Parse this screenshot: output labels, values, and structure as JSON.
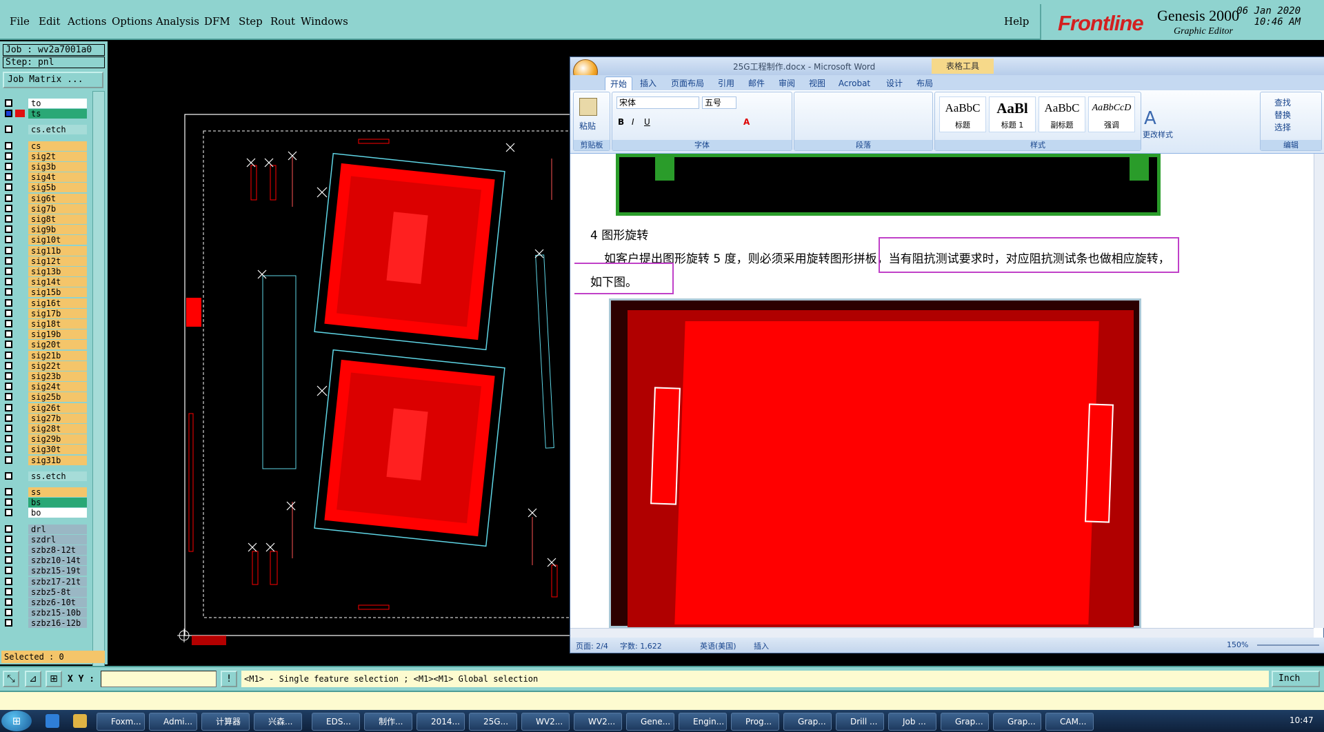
{
  "menu": {
    "file": "File",
    "edit": "Edit",
    "actions": "Actions",
    "options": "Options",
    "analysis": "Analysis",
    "dfm": "DFM",
    "step": "Step",
    "rout": "Rout",
    "windows": "Windows",
    "help": "Help"
  },
  "brand": {
    "logo": "Frontline",
    "product": "Genesis 2000",
    "module": "Graphic Editor",
    "date": "06 Jan 2020",
    "time": "10:46 AM"
  },
  "panel": {
    "job": "Job : wv2a7001a0",
    "step": "Step: pnl",
    "job_matrix": "Job Matrix ...",
    "selected": "Selected : 0",
    "layers": [
      {
        "name": "to",
        "color": "#ffffff"
      },
      {
        "name": "ts",
        "color": "#2aa876"
      },
      {
        "name": "cs.etch",
        "color": "#a6dcd8"
      },
      {
        "name": "cs",
        "color": "#f4c56a"
      },
      {
        "name": "sig2t",
        "color": "#f4c56a"
      },
      {
        "name": "sig3b",
        "color": "#f4c56a"
      },
      {
        "name": "sig4t",
        "color": "#f4c56a"
      },
      {
        "name": "sig5b",
        "color": "#f4c56a"
      },
      {
        "name": "sig6t",
        "color": "#f4c56a"
      },
      {
        "name": "sig7b",
        "color": "#f4c56a"
      },
      {
        "name": "sig8t",
        "color": "#f4c56a"
      },
      {
        "name": "sig9b",
        "color": "#f4c56a"
      },
      {
        "name": "sig10t",
        "color": "#f4c56a"
      },
      {
        "name": "sig11b",
        "color": "#f4c56a"
      },
      {
        "name": "sig12t",
        "color": "#f4c56a"
      },
      {
        "name": "sig13b",
        "color": "#f4c56a"
      },
      {
        "name": "sig14t",
        "color": "#f4c56a"
      },
      {
        "name": "sig15b",
        "color": "#f4c56a"
      },
      {
        "name": "sig16t",
        "color": "#f4c56a"
      },
      {
        "name": "sig17b",
        "color": "#f4c56a"
      },
      {
        "name": "sig18t",
        "color": "#f4c56a"
      },
      {
        "name": "sig19b",
        "color": "#f4c56a"
      },
      {
        "name": "sig20t",
        "color": "#f4c56a"
      },
      {
        "name": "sig21b",
        "color": "#f4c56a"
      },
      {
        "name": "sig22t",
        "color": "#f4c56a"
      },
      {
        "name": "sig23b",
        "color": "#f4c56a"
      },
      {
        "name": "sig24t",
        "color": "#f4c56a"
      },
      {
        "name": "sig25b",
        "color": "#f4c56a"
      },
      {
        "name": "sig26t",
        "color": "#f4c56a"
      },
      {
        "name": "sig27b",
        "color": "#f4c56a"
      },
      {
        "name": "sig28t",
        "color": "#f4c56a"
      },
      {
        "name": "sig29b",
        "color": "#f4c56a"
      },
      {
        "name": "sig30t",
        "color": "#f4c56a"
      },
      {
        "name": "sig31b",
        "color": "#f4c56a"
      },
      {
        "name": "ss.etch",
        "color": "#a6dcd8"
      },
      {
        "name": "ss",
        "color": "#f4c56a"
      },
      {
        "name": "bs",
        "color": "#2aa876"
      },
      {
        "name": "bo",
        "color": "#ffffff"
      },
      {
        "name": "drl",
        "color": "#9ab7c4"
      },
      {
        "name": "szdrl",
        "color": "#9ab7c4"
      },
      {
        "name": "szbz8-12t",
        "color": "#9ab7c4"
      },
      {
        "name": "szbz10-14t",
        "color": "#9ab7c4"
      },
      {
        "name": "szbz15-19t",
        "color": "#9ab7c4"
      },
      {
        "name": "szbz17-21t",
        "color": "#9ab7c4"
      },
      {
        "name": "szbz5-8t",
        "color": "#9ab7c4"
      },
      {
        "name": "szbz6-10t",
        "color": "#9ab7c4"
      },
      {
        "name": "szbz15-10b",
        "color": "#9ab7c4"
      },
      {
        "name": "szbz16-12b",
        "color": "#9ab7c4"
      }
    ]
  },
  "status": {
    "xy_label": "X Y :",
    "xy_value": "",
    "hint": "<M1> - Single feature selection ; <M1><M1> Global selection",
    "units": "Inch"
  },
  "word": {
    "title": "25G工程制作.docx - Microsoft Word",
    "context_tab": "表格工具",
    "tabs": [
      "开始",
      "插入",
      "页面布局",
      "引用",
      "邮件",
      "审阅",
      "视图",
      "Acrobat",
      "设计",
      "布局"
    ],
    "groups": {
      "clipboard": "剪贴板",
      "font": "字体",
      "paragraph": "段落",
      "styles": "样式",
      "editing": "编辑"
    },
    "paste": "粘贴",
    "font_name": "宋体",
    "font_size": "五号",
    "styles": [
      {
        "preview": "AaBbC",
        "name": "标题"
      },
      {
        "preview": "AaBl",
        "name": "标题 1"
      },
      {
        "preview": "AaBbC",
        "name": "副标题"
      },
      {
        "preview": "AaBbCcD",
        "name": "强调"
      }
    ],
    "change_styles": "更改样式",
    "find": "查找",
    "replace": "替换",
    "select": "选择",
    "heading": "4 图形旋转",
    "para1": "如客户提出图形旋转 5 度，则必须采用旋转图形拼板，当有阻抗测试要求时，对应阻抗测试条也做相应旋转，",
    "para2": "如下图。",
    "status_page": "页面: 2/4",
    "status_words": "字数: 1,622",
    "status_lang": "英语(美国)",
    "status_mode": "插入",
    "zoom": "150%"
  },
  "taskbar": {
    "items": [
      "Foxm...",
      "Admi...",
      "计算器",
      "兴森...",
      "EDS...",
      "制作...",
      "2014...",
      "25G...",
      "WV2...",
      "WV2...",
      "Gene...",
      "Engin...",
      "Prog...",
      "Grap...",
      "Drill ...",
      "Job ...",
      "Grap...",
      "Grap...",
      "CAM..."
    ],
    "clock": "10:47"
  },
  "colors": {
    "teal": "#8fd3cf",
    "pcb_red": "#ff0000",
    "outline_cyan": "#5fd6e6",
    "annot_magenta": "#c040c8"
  }
}
